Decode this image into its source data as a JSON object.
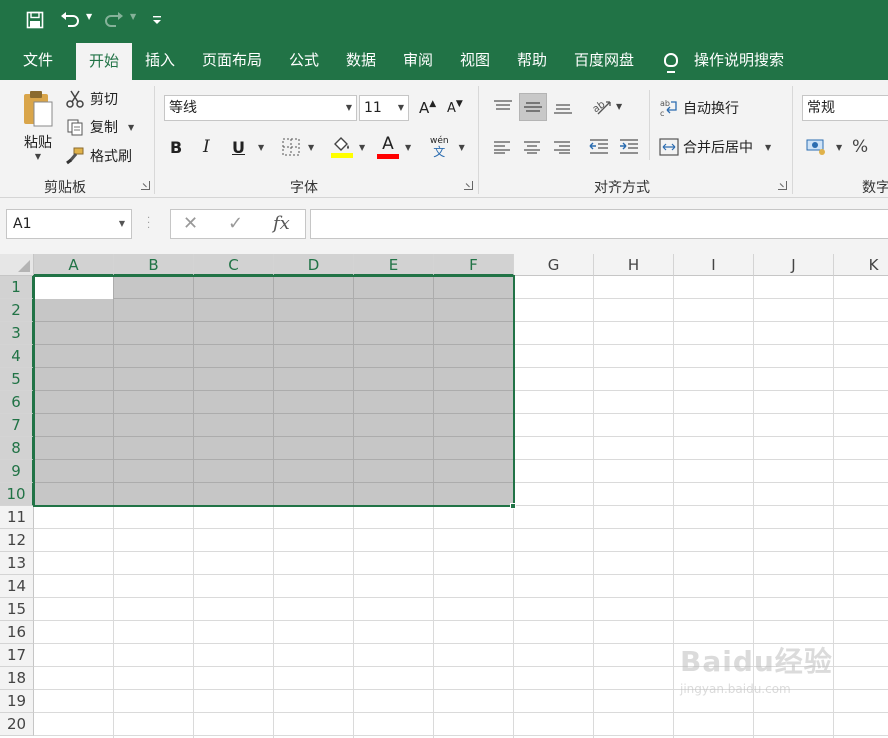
{
  "qat": {
    "save_icon": "save-icon",
    "undo_icon": "undo-icon",
    "redo_icon": "redo-icon",
    "customize_icon": "customize-qat-icon"
  },
  "tabs": [
    {
      "label": "文件",
      "active": false
    },
    {
      "label": "开始",
      "active": true
    },
    {
      "label": "插入",
      "active": false
    },
    {
      "label": "页面布局",
      "active": false
    },
    {
      "label": "公式",
      "active": false
    },
    {
      "label": "数据",
      "active": false
    },
    {
      "label": "审阅",
      "active": false
    },
    {
      "label": "视图",
      "active": false
    },
    {
      "label": "帮助",
      "active": false
    },
    {
      "label": "百度网盘",
      "active": false
    }
  ],
  "tell_me": "操作说明搜索",
  "clipboard": {
    "paste": "粘贴",
    "cut": "剪切",
    "copy": "复制",
    "format_painter": "格式刷",
    "group_label": "剪贴板"
  },
  "font": {
    "font_name": "等线",
    "font_size": "11",
    "grow": "A",
    "shrink": "A",
    "bold": "B",
    "italic": "I",
    "underline": "U",
    "phonetic_top": "wén",
    "phonetic_bottom": "文",
    "font_color_letter": "A",
    "group_label": "字体",
    "fill_color": "#ffff00",
    "font_color": "#ff0000"
  },
  "alignment": {
    "wrap_text": "自动换行",
    "merge_center": "合并后居中",
    "group_label": "对齐方式"
  },
  "number": {
    "format": "常规",
    "percent": "%",
    "group_label": "数字"
  },
  "formula_bar": {
    "name_box": "A1",
    "cancel": "✕",
    "enter": "✓",
    "function": "fx",
    "content": ""
  },
  "grid": {
    "columns": [
      "A",
      "B",
      "C",
      "D",
      "E",
      "F",
      "G",
      "H",
      "I",
      "J",
      "K"
    ],
    "rows": [
      "1",
      "2",
      "3",
      "4",
      "5",
      "6",
      "7",
      "8",
      "9",
      "10",
      "11",
      "12",
      "13",
      "14",
      "15",
      "16",
      "17",
      "18",
      "19",
      "20"
    ],
    "selection": "A1:F10",
    "accent": "#217346"
  },
  "watermark": {
    "brand": "Baidu经验",
    "url": "jingyan.baidu.com"
  }
}
